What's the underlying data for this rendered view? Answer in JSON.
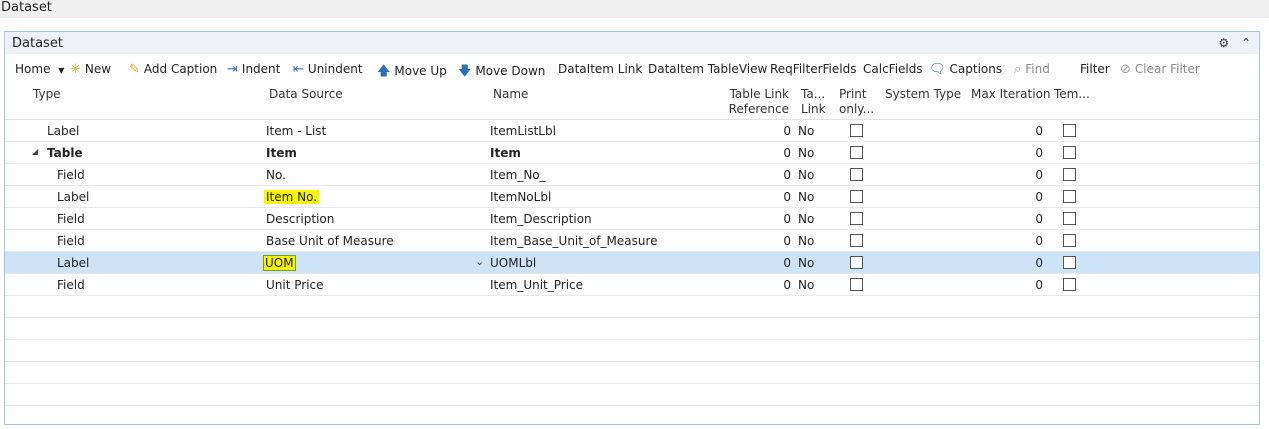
{
  "window": {
    "title": "Dataset"
  },
  "panel": {
    "title": "Dataset"
  },
  "toolbar": {
    "home": "Home",
    "new": "New",
    "add_caption": "Add Caption",
    "indent": "Indent",
    "unindent": "Unindent",
    "move_up": "Move Up",
    "move_down": "Move Down",
    "dataitem_link": "DataItem Link",
    "dataitem_tableview": "DataItem TableView",
    "reqfilterfields": "ReqFilterFields",
    "calcfields": "CalcFields",
    "captions": "Captions",
    "find": "Find",
    "filter": "Filter",
    "clear_filter": "Clear Filter"
  },
  "columns": {
    "type": "Type",
    "data_source": "Data Source",
    "name": "Name",
    "table_link_ref_1": "Table Link",
    "table_link_ref_2": "Reference",
    "ta_link_1": "Ta...",
    "ta_link_2": "Link",
    "print_only_1": "Print",
    "print_only_2": "only...",
    "system_type": "System Type",
    "max_iteration": "Max Iteration",
    "tem": "Tem..."
  },
  "rows": [
    {
      "type": "Label",
      "source": "Item - List",
      "name": "ItemListLbl",
      "ref": "0",
      "link": "No",
      "max": "0"
    },
    {
      "type": "Table",
      "source": "Item",
      "name": "Item",
      "ref": "0",
      "link": "No",
      "max": "0"
    },
    {
      "type": "Field",
      "source": "No.",
      "name": "Item_No_",
      "ref": "0",
      "link": "No",
      "max": "0"
    },
    {
      "type": "Label",
      "source": "Item No.",
      "name": "ItemNoLbl",
      "ref": "0",
      "link": "No",
      "max": "0"
    },
    {
      "type": "Field",
      "source": "Description",
      "name": "Item_Description",
      "ref": "0",
      "link": "No",
      "max": "0"
    },
    {
      "type": "Field",
      "source": "Base Unit of Measure",
      "name": "Item_Base_Unit_of_Measure",
      "ref": "0",
      "link": "No",
      "max": "0"
    },
    {
      "type": "Label",
      "source": "UOM",
      "name": "UOMLbl",
      "ref": "0",
      "link": "No",
      "max": "0"
    },
    {
      "type": "Field",
      "source": "Unit Price",
      "name": "Item_Unit_Price",
      "ref": "0",
      "link": "No",
      "max": "0"
    }
  ]
}
